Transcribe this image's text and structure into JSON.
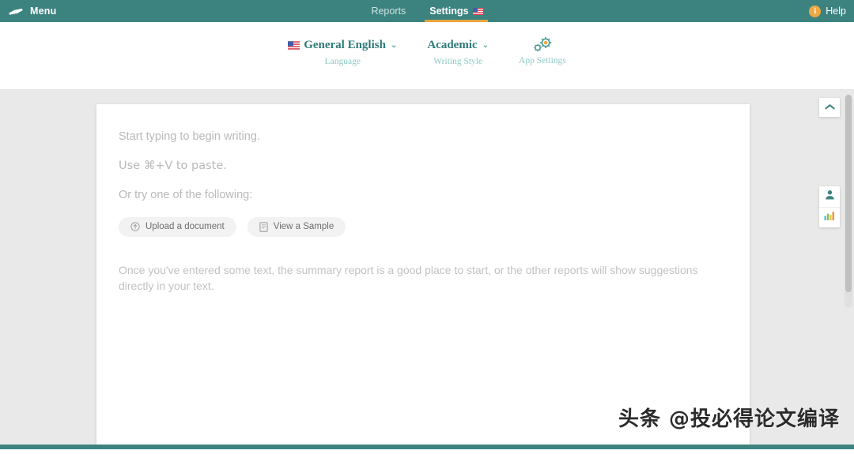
{
  "header": {
    "logo_icon": "writing-app-logo",
    "menu_label": "Menu",
    "nav": [
      {
        "label": "Reports",
        "active": false,
        "icon": null
      },
      {
        "label": "Settings",
        "active": true,
        "icon": "us-flag-icon"
      }
    ],
    "help": {
      "icon": "info-icon",
      "icon_glyph": "i",
      "label": "Help"
    },
    "background_color": "#3c8380",
    "active_underline_color": "#e8a33d",
    "help_icon_color": "#f0a842"
  },
  "settings_bar": {
    "items": [
      {
        "icon": "us-flag-icon",
        "value": "General English",
        "caret": "⌄",
        "sub_label": "Language",
        "has_caret": true,
        "has_gears": false
      },
      {
        "icon": null,
        "value": "Academic",
        "caret": "⌄",
        "sub_label": "Writing Style",
        "has_caret": true,
        "has_gears": false
      },
      {
        "icon": "gears-icon",
        "value": "",
        "caret": "",
        "sub_label": "App Settings",
        "has_caret": false,
        "has_gears": true
      }
    ],
    "accent_color": "#2e7b78",
    "sub_label_color": "#8ecac6"
  },
  "document": {
    "placeholder_lines": [
      "Start typing to begin writing.",
      "Use ⌘+V to paste.",
      "Or try one of the following:"
    ],
    "buttons": [
      {
        "icon": "upload-icon",
        "label": "Upload a document"
      },
      {
        "icon": "document-icon",
        "label": "View a Sample"
      }
    ],
    "summary_text": "Once you've entered some text, the summary report is a good place to start, or the other reports will show suggestions directly in your text."
  },
  "right_rail": {
    "collapse_icon": "chevron-up-icon",
    "buttons": [
      {
        "icon": "person-icon",
        "name": "audience-report"
      },
      {
        "icon": "bar-chart-icon",
        "name": "summary-report"
      }
    ]
  },
  "watermark": {
    "text": "头条 @投必得论文编译"
  }
}
